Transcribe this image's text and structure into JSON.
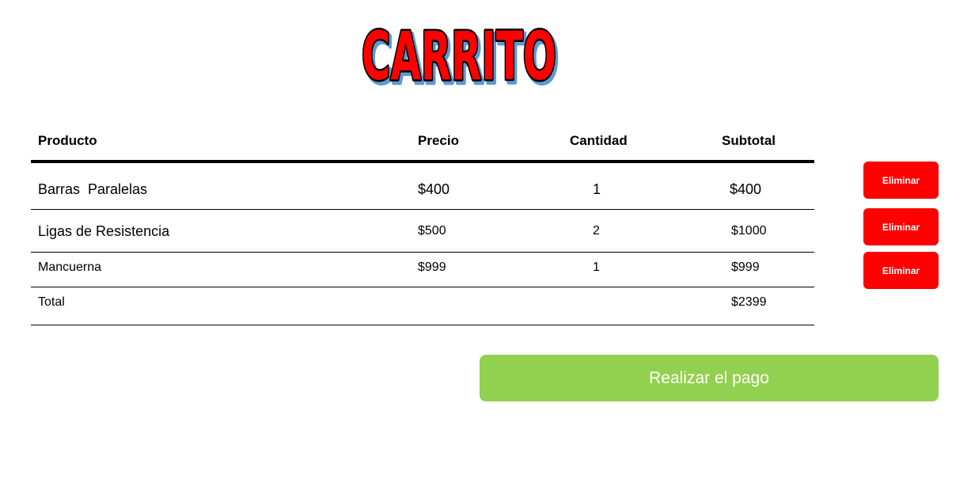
{
  "header": {
    "title": "CARRITO",
    "title_colors": {
      "fill": "#ff0000",
      "outline": "#000000",
      "shadow": "#5b9bd5"
    }
  },
  "table": {
    "columns": [
      "Producto",
      "Precio",
      "Cantidad",
      "Subtotal"
    ],
    "rows": [
      {
        "product": "Barras  Paralelas",
        "price": "$400",
        "quantity": "1",
        "subtotal": "$400"
      },
      {
        "product": "Ligas de Resistencia",
        "price": "$500",
        "quantity": "2",
        "subtotal": "$1000"
      },
      {
        "product": "Mancuerna",
        "price": "$999",
        "quantity": "1",
        "subtotal": "$999"
      }
    ],
    "total_label": "Total",
    "total_value": "$2399"
  },
  "actions": {
    "delete_label": "Eliminar",
    "delete_color": "#ff0000",
    "pay_label": "Realizar el pago",
    "pay_color": "#92d050"
  }
}
